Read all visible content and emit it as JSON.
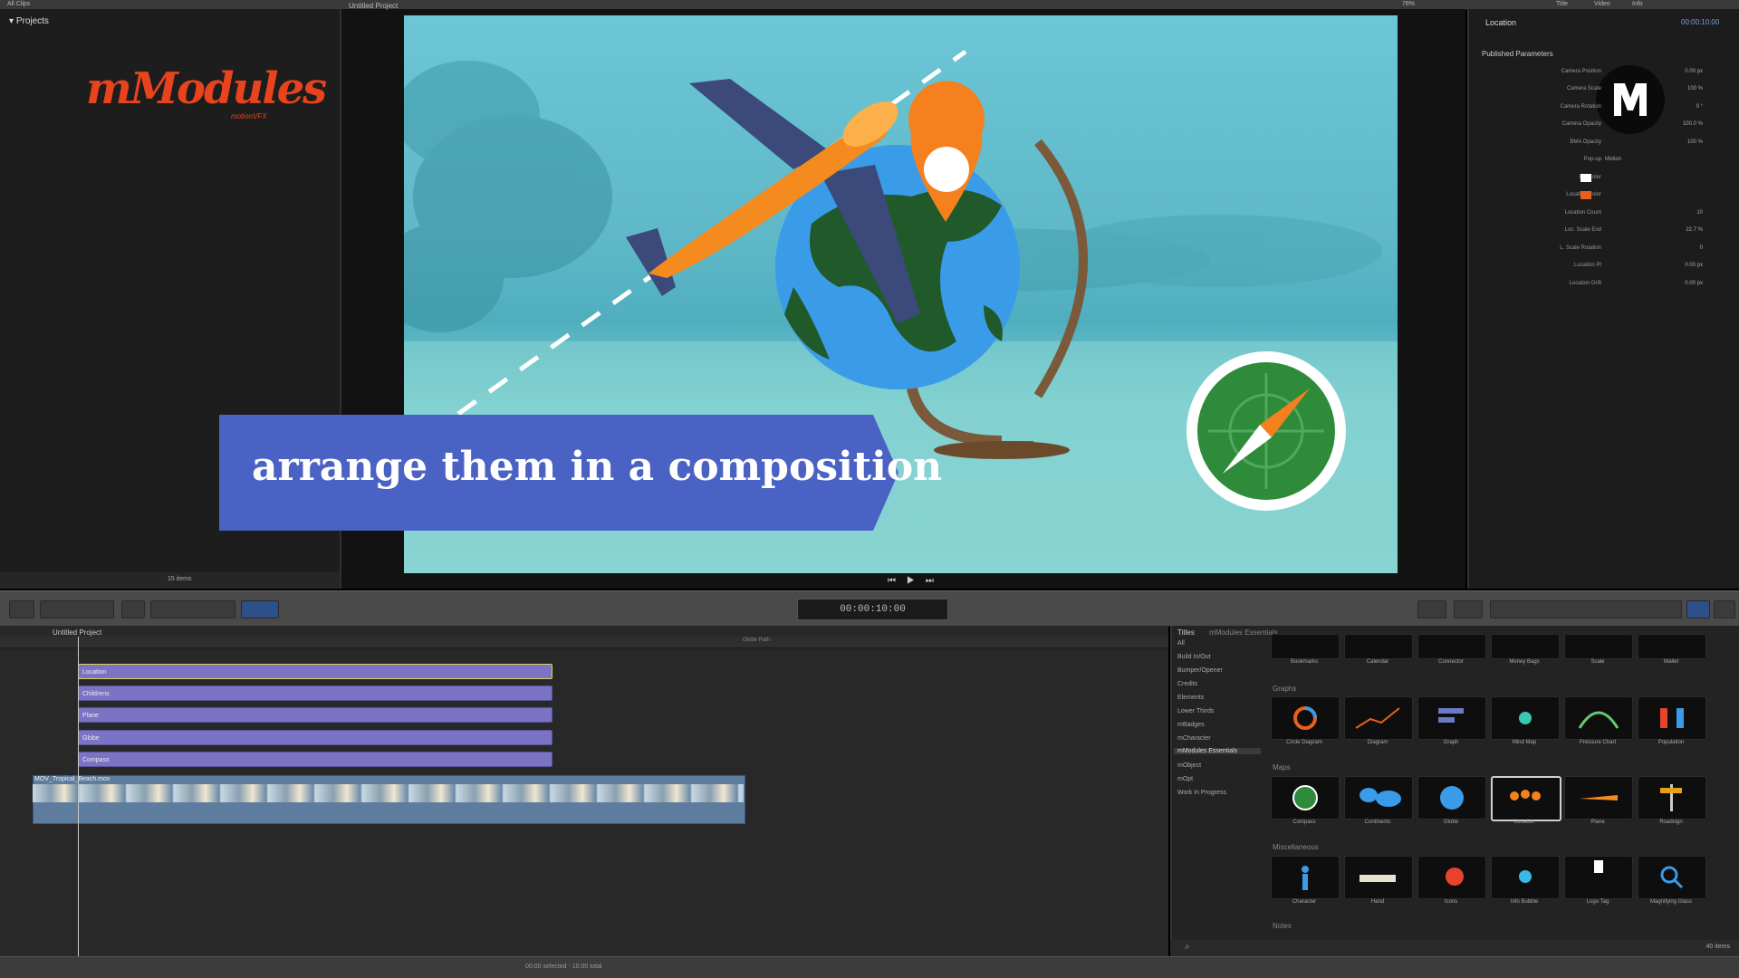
{
  "app": {
    "top_left_label": "All Clips",
    "top_tabs": [
      "Title",
      "Video",
      "Info"
    ],
    "zoom_label": "78%"
  },
  "library": {
    "header": "Projects",
    "logo_text": "mModules",
    "logo_sub": "motionVFX",
    "items_label": "15 items"
  },
  "viewer": {
    "project_name": "Untitled Project",
    "caption": "arrange them in a composition"
  },
  "inspector": {
    "title": "Location",
    "timecode": "00:00:10:00",
    "section": "Published Parameters",
    "params": [
      {
        "label": "Camera Position",
        "value": "0.00 px"
      },
      {
        "label": "Camera Scale",
        "value": "100 %"
      },
      {
        "label": "Camera Rotation",
        "value": "0 °"
      },
      {
        "label": "Camera Opacity",
        "value": "100.0 %"
      },
      {
        "label": "BMA Opacity",
        "value": "100 %"
      },
      {
        "label": "Pop-up",
        "value": "Motion"
      },
      {
        "label": "Pin Color",
        "value": ""
      },
      {
        "label": "Location Color",
        "value": ""
      },
      {
        "label": "Location Count",
        "value": "10"
      },
      {
        "label": "Loc. Scale End",
        "value": "22.7 %"
      },
      {
        "label": "L. Scale Rotation",
        "value": "0"
      },
      {
        "label": "Location Pt",
        "value": "0.00 px"
      },
      {
        "label": "Location Drift",
        "value": "0.00 px"
      }
    ],
    "colors": {
      "pin": "#ffffff",
      "location": "#e8601c"
    }
  },
  "toolbar": {
    "timecode": "00:00:10:00"
  },
  "timeline": {
    "project_name": "Untitled Project",
    "title_clips": [
      "Location",
      "Childrens",
      "Plane",
      "Globe",
      "Compass"
    ],
    "video_clip": "MOV_Tropical_Beach.mov",
    "center_label": "Globe Path"
  },
  "browser": {
    "header": "Titles",
    "header_sub": "mModules Essentials",
    "categories": [
      "All",
      "Build In/Out",
      "Bumper/Opener",
      "Credits",
      "Elements",
      "Lower Thirds",
      "mBadges",
      "mCharacter",
      "mModules Essentials",
      "mObject",
      "mOpt",
      "Work In Progress"
    ],
    "sections": {
      "graphs": "Graphs",
      "maps": "Maps",
      "misc": "Miscellaneous",
      "notes": "Notes"
    },
    "row1": [
      "Bookmarks",
      "Calendar",
      "Connector",
      "Money Bags",
      "Scale",
      "Wallet"
    ],
    "row2": [
      "Circle Diagram",
      "Diagram",
      "Graph",
      "Mind Map",
      "Pressure Chart",
      "Population"
    ],
    "row3": [
      "Compass",
      "Continents",
      "Globe",
      "Location",
      "Plane",
      "Roadsign"
    ],
    "row4": [
      "Character",
      "Hand",
      "Icons",
      "Info Bubble",
      "Logo Tag",
      "Magnifying Glass"
    ],
    "count": "40 items"
  },
  "status": {
    "center": "00:00 selected - 10:00 total"
  }
}
